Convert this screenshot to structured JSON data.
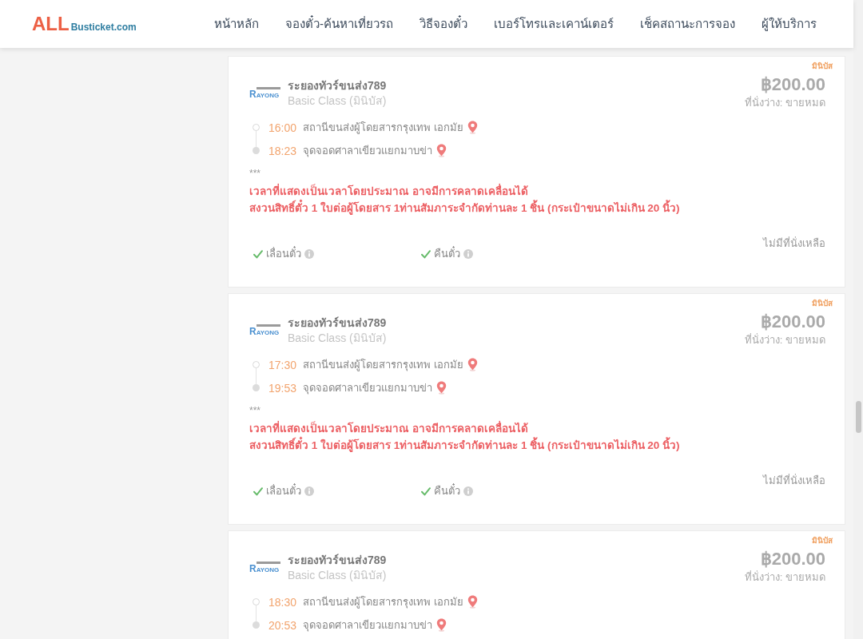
{
  "header": {
    "logo": {
      "brand": "ALL",
      "domain": "Busticket.com"
    },
    "nav": [
      "หน้าหลัก",
      "จองตั๋ว-ค้นหาเที่ยวรถ",
      "วิธีจองตั๋ว",
      "เบอร์โทรและเคาน์เตอร์",
      "เช็คสถานะการจอง",
      "ผู้ให้บริการ"
    ]
  },
  "trips": [
    {
      "badge": "มินิบัส",
      "operator": {
        "logo_text": "RAYONG",
        "name": "ระยองทัวร์ขนส่ง789",
        "class": "Basic Class (มินิบัส)"
      },
      "price": "฿200.00",
      "seats": "ที่นั่งว่าง: ขายหมด",
      "stops": [
        {
          "kind": "departure",
          "time": "16:00",
          "place": "สถานีขนส่งผู้โดยสารกรุงเทพ เอกมัย"
        },
        {
          "kind": "arrival",
          "time": "18:23",
          "place": "จุดจอดศาลาเขียวแยกมาบข่า"
        }
      ],
      "note_marker": "***",
      "notes": [
        "เวลาที่แสดงเป็นเวลาโดยประมาณ อาจมีการคลาดเคลื่อนได้",
        "สงวนสิทธิ์ตั๋ว 1 ใบต่อผู้โดยสาร 1ท่านสัมภาระจำกัดท่านละ 1 ชิ้น (กระเป๋าขนาดไม่เกิน 20 นิ้ว)"
      ],
      "policies": [
        {
          "label": "เลื่อนตั๋ว",
          "allowed": true
        },
        {
          "label": "คืนตั๋ว",
          "allowed": true
        }
      ],
      "availability": "ไม่มีที่นั่งเหลือ"
    },
    {
      "badge": "มินิบัส",
      "operator": {
        "logo_text": "RAYONG",
        "name": "ระยองทัวร์ขนส่ง789",
        "class": "Basic Class (มินิบัส)"
      },
      "price": "฿200.00",
      "seats": "ที่นั่งว่าง: ขายหมด",
      "stops": [
        {
          "kind": "departure",
          "time": "17:30",
          "place": "สถานีขนส่งผู้โดยสารกรุงเทพ เอกมัย"
        },
        {
          "kind": "arrival",
          "time": "19:53",
          "place": "จุดจอดศาลาเขียวแยกมาบข่า"
        }
      ],
      "note_marker": "***",
      "notes": [
        "เวลาที่แสดงเป็นเวลาโดยประมาณ อาจมีการคลาดเคลื่อนได้",
        "สงวนสิทธิ์ตั๋ว 1 ใบต่อผู้โดยสาร 1ท่านสัมภาระจำกัดท่านละ 1 ชิ้น (กระเป๋าขนาดไม่เกิน 20 นิ้ว)"
      ],
      "policies": [
        {
          "label": "เลื่อนตั๋ว",
          "allowed": true
        },
        {
          "label": "คืนตั๋ว",
          "allowed": true
        }
      ],
      "availability": "ไม่มีที่นั่งเหลือ"
    },
    {
      "badge": "มินิบัส",
      "operator": {
        "logo_text": "RAYONG",
        "name": "ระยองทัวร์ขนส่ง789",
        "class": "Basic Class (มินิบัส)"
      },
      "price": "฿200.00",
      "seats": "ที่นั่งว่าง: ขายหมด",
      "stops": [
        {
          "kind": "departure",
          "time": "18:30",
          "place": "สถานีขนส่งผู้โดยสารกรุงเทพ เอกมัย"
        },
        {
          "kind": "arrival",
          "time": "20:53",
          "place": "จุดจอดศาลาเขียวแยกมาบข่า"
        }
      ]
    }
  ]
}
